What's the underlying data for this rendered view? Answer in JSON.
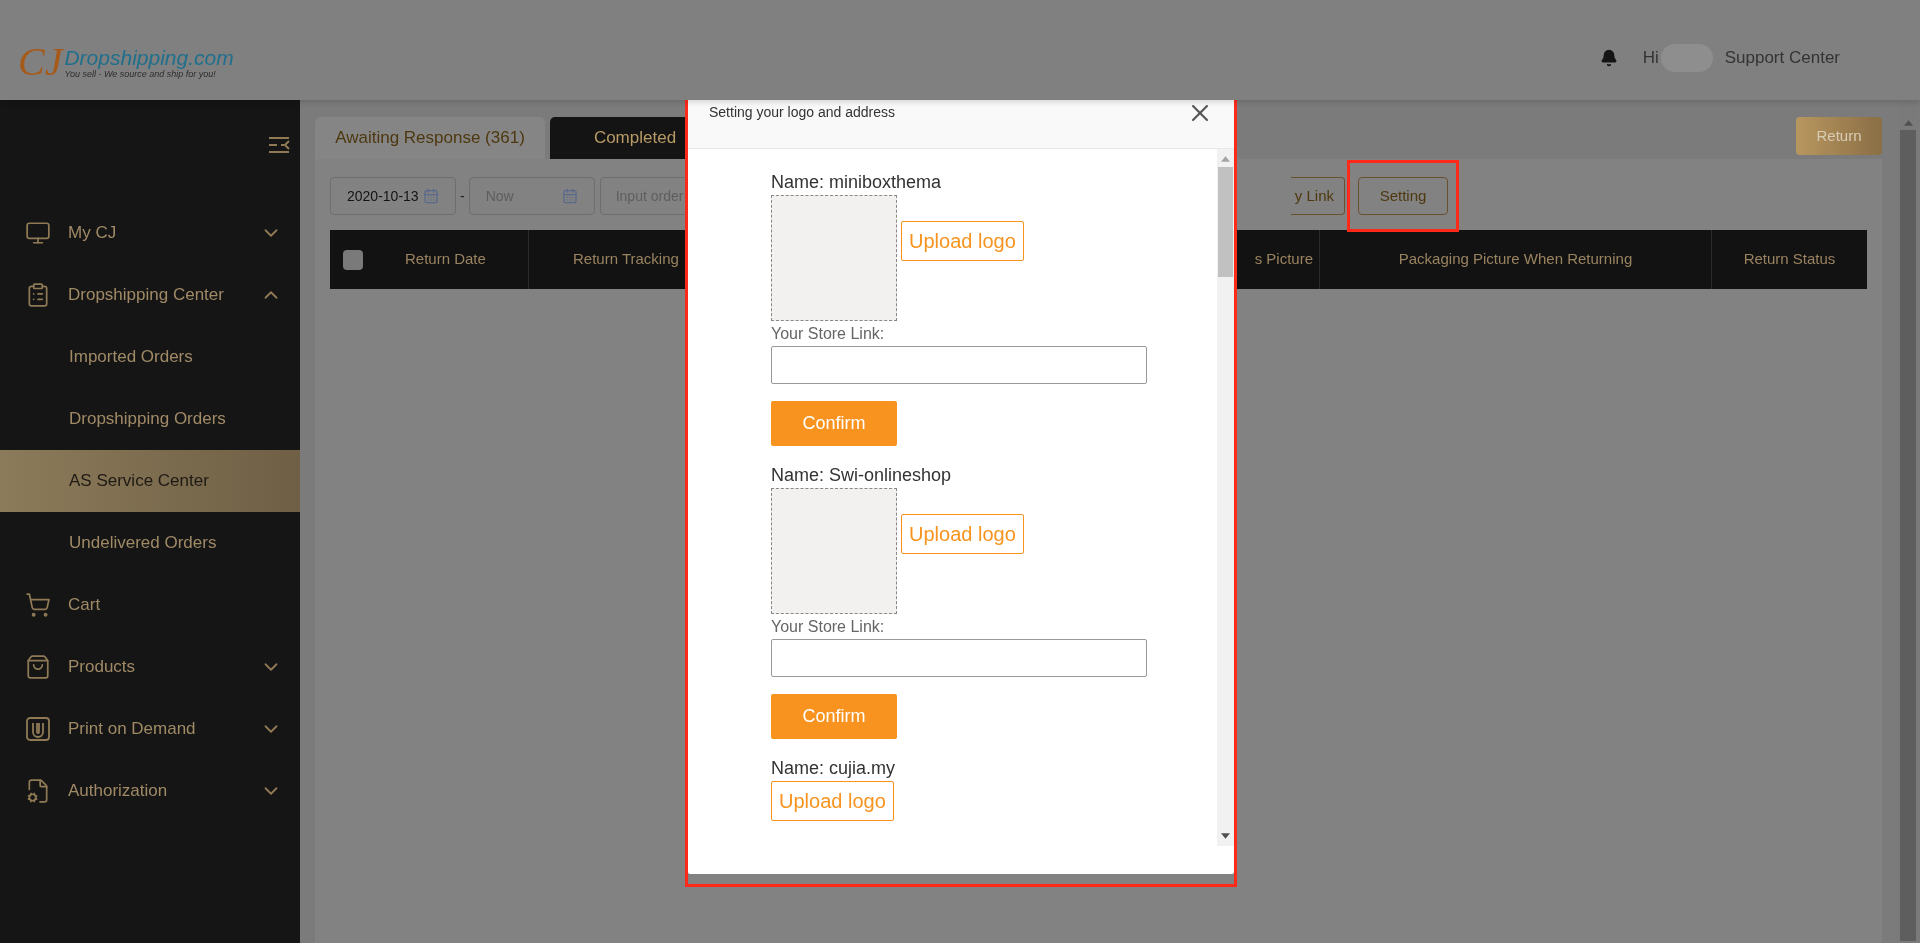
{
  "header": {
    "logo": {
      "mark": "CJ",
      "name": "Dropshipping.com",
      "tagline": "You sell - We source and ship for you!"
    },
    "greeting": "Hi",
    "support_link": "Support Center"
  },
  "sidebar": {
    "items": [
      {
        "label": "My CJ",
        "kind": "monitor",
        "expanded": false,
        "selected": false
      },
      {
        "label": "Dropshipping Center",
        "kind": "clipboard",
        "expanded": true,
        "selected": false,
        "children": [
          {
            "label": "Imported Orders",
            "selected": false
          },
          {
            "label": "Dropshipping Orders",
            "selected": false
          },
          {
            "label": "AS Service Center",
            "selected": true
          },
          {
            "label": "Undelivered Orders",
            "selected": false
          }
        ]
      },
      {
        "label": "Cart",
        "kind": "cart",
        "selected": false
      },
      {
        "label": "Products",
        "kind": "bag",
        "expanded": false,
        "selected": false
      },
      {
        "label": "Print on Demand",
        "kind": "print",
        "expanded": false,
        "selected": false
      },
      {
        "label": "Authorization",
        "kind": "file",
        "expanded": false,
        "selected": false
      }
    ]
  },
  "tabs": [
    {
      "label": "Awaiting Response (361)",
      "selected": true
    },
    {
      "label": "Completed",
      "selected": false
    }
  ],
  "return_button": "Return",
  "filters": {
    "date_from": "2020-10-13",
    "separator": "-",
    "date_to_placeholder": "Now",
    "order_placeholder": "Input order"
  },
  "toolbar_buttons": [
    {
      "label": "y Link",
      "highlighted": false
    },
    {
      "label": "Setting",
      "highlighted": true
    }
  ],
  "table": {
    "select_all": {
      "checked": false
    },
    "columns": [
      "Return Date",
      "Return Tracking",
      "s Picture",
      "Packaging Picture When Returning",
      "Return Status"
    ]
  },
  "modal": {
    "title": "Setting your logo and address",
    "highlighted": true,
    "stores": [
      {
        "name": "Name: miniboxthema",
        "logo_preview": true,
        "upload": "Upload logo",
        "link_label": "Your Store Link:",
        "confirm": "Confirm"
      },
      {
        "name": "Name: Swi-onlineshop",
        "logo_preview": true,
        "upload": "Upload logo",
        "link_label": "Your Store Link:",
        "confirm": "Confirm"
      },
      {
        "name": "Name: cujia.my",
        "logo_preview": false,
        "upload": "Upload logo"
      }
    ]
  }
}
